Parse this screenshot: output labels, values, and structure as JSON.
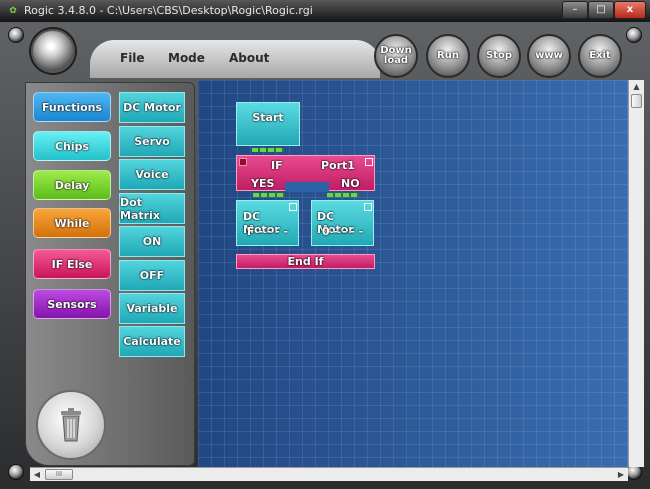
{
  "window": {
    "title": "Rogic 3.4.8.0 - C:\\Users\\CBS\\Desktop\\Rogic\\Rogic.rgi",
    "minimize": "–",
    "maximize": "□",
    "close": "x"
  },
  "menu": {
    "file": "File",
    "mode": "Mode",
    "about": "About"
  },
  "toolbar": {
    "download": [
      "Down",
      "load"
    ],
    "run": "Run",
    "stop": "Stop",
    "www": "www",
    "exit": "Exit"
  },
  "categories": [
    "Functions",
    "Chips",
    "Delay",
    "While",
    "IF Else",
    "Sensors"
  ],
  "category_colors": [
    "#2f9ee6",
    "#3fe0ea",
    "#7ddc2c",
    "#f08a12",
    "#e52a72",
    "#a126c8"
  ],
  "blocks": [
    "DC Motor",
    "Servo",
    "Voice",
    "Dot Matrix",
    "ON",
    "OFF",
    "Variable",
    "Calculate"
  ],
  "program": {
    "start": "Start",
    "if_label": "IF",
    "port": "Port1",
    "yes": "YES",
    "no": "NO",
    "motor1": {
      "label": "DC Motor",
      "value": "F - - - -"
    },
    "motor2": {
      "label": "DC Motor",
      "value": "0 - - - -"
    },
    "end_if": "End If"
  },
  "scrollbar": {
    "thumb": "III"
  }
}
